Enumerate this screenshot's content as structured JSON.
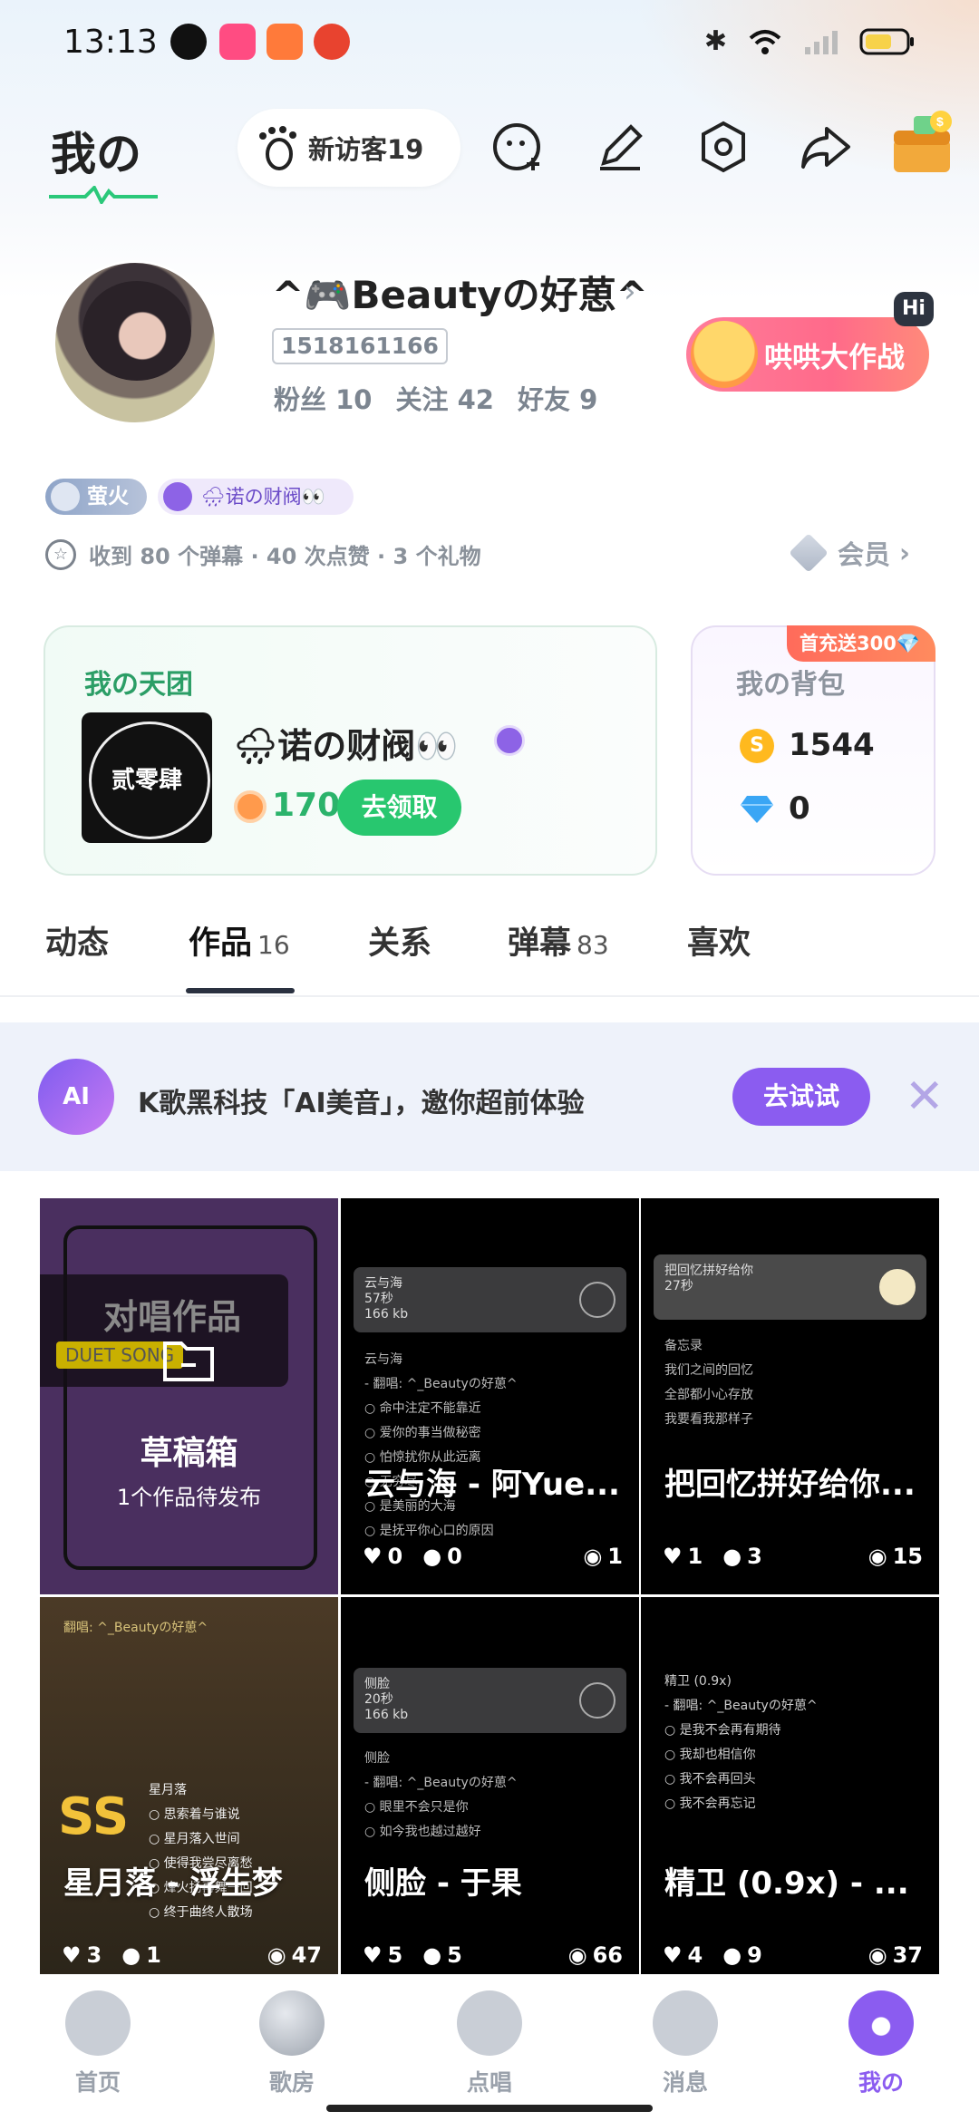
{
  "status_bar": {
    "time": "13:13"
  },
  "header": {
    "title": "我の",
    "visitor_label": "新访客19"
  },
  "profile": {
    "nickname": "^🎮Beautyの好葸^",
    "uid": "1518161166",
    "fans_label": "粉丝",
    "fans": "10",
    "follow_label": "关注",
    "follow": "42",
    "friends_label": "好友",
    "friends": "9",
    "game_button": "哄哄大作战",
    "hi_badge": "Hi"
  },
  "badges": {
    "firefly": "萤火",
    "group": "🌧诺の财阀👀"
  },
  "received": "收到 80 个弹幕 · 40 次点赞 · 3 个礼物",
  "member_label": "会员",
  "group_card": {
    "title": "我の天团",
    "image_text": "贰零肆",
    "name": "🌧诺の财阀👀",
    "points": "170",
    "claim_button": "去领取"
  },
  "bag_card": {
    "tag": "首充送300💎",
    "title": "我の背包",
    "coins": "1544",
    "diamonds": "0"
  },
  "tabs": [
    {
      "label": "动态",
      "count": ""
    },
    {
      "label": "作品",
      "count": "16"
    },
    {
      "label": "关系",
      "count": ""
    },
    {
      "label": "弹幕",
      "count": "83"
    },
    {
      "label": "喜欢",
      "count": ""
    }
  ],
  "ai_banner": {
    "icon_text": "AI",
    "text": "K歌黑科技「AI美音」，邀你超前体验",
    "button": "去试试"
  },
  "draft": {
    "duet_title": "对唱作品",
    "duet_sub": "DUET SONG",
    "title": "草稿箱",
    "subtitle": "1个作品待发布"
  },
  "works": [
    {
      "title": "云与海 - 阿Yue...",
      "likes": "0",
      "comments": "0",
      "plays": "1",
      "panel": "云与海\n57秒\n166 kb",
      "lines": "云与海\n- 翻唱: ^_Beautyの好葸^\n○ 命中注定不能靠近\n○ 爱你的事当做秘密\n○ 怕惊扰你从此远离\n○ 无穷尽\n○ 是美丽的大海\n○ 是抚平你心口的原因"
    },
    {
      "title": "把回忆拼好给你...",
      "likes": "1",
      "comments": "3",
      "plays": "15",
      "panel": "把回忆拼好给你\n27秒",
      "lines": "备忘录\n我们之间的回忆\n全部都小心存放\n我要看我那样子"
    },
    {
      "title": "星月落 - 浮生梦",
      "likes": "3",
      "comments": "1",
      "plays": "47",
      "panel": "翻唱: ^_Beautyの好葸^",
      "lines": "星月落\n○ 思索着与谁说\n○ 星月落入世间\n○ 使得我尝尽离愁\n○ 烽火扬再舞一回\n○ 终于曲终人散场"
    },
    {
      "title": "侧脸 - 于果",
      "likes": "5",
      "comments": "5",
      "plays": "66",
      "panel": "侧脸\n20秒\n166 kb",
      "lines": "侧脸\n- 翻唱: ^_Beautyの好葸^\n○ 眼里不会只是你\n○ 如今我也越过越好"
    },
    {
      "title": "精卫 (0.9x) - ...",
      "likes": "4",
      "comments": "9",
      "plays": "37",
      "panel": "",
      "lines": "精卫 (0.9x)\n- 翻唱: ^_Beautyの好葸^\n○ 是我不会再有期待\n○ 我却也相信你\n○ 我不会再回头\n○ 我不会再忘记"
    }
  ],
  "nav": [
    {
      "label": "首页"
    },
    {
      "label": "歌房"
    },
    {
      "label": "点唱"
    },
    {
      "label": "消息"
    },
    {
      "label": "我の"
    }
  ],
  "colors": {
    "accent": "#8b5cf0",
    "green": "#28c76f",
    "pink": "#ff6a8a"
  }
}
